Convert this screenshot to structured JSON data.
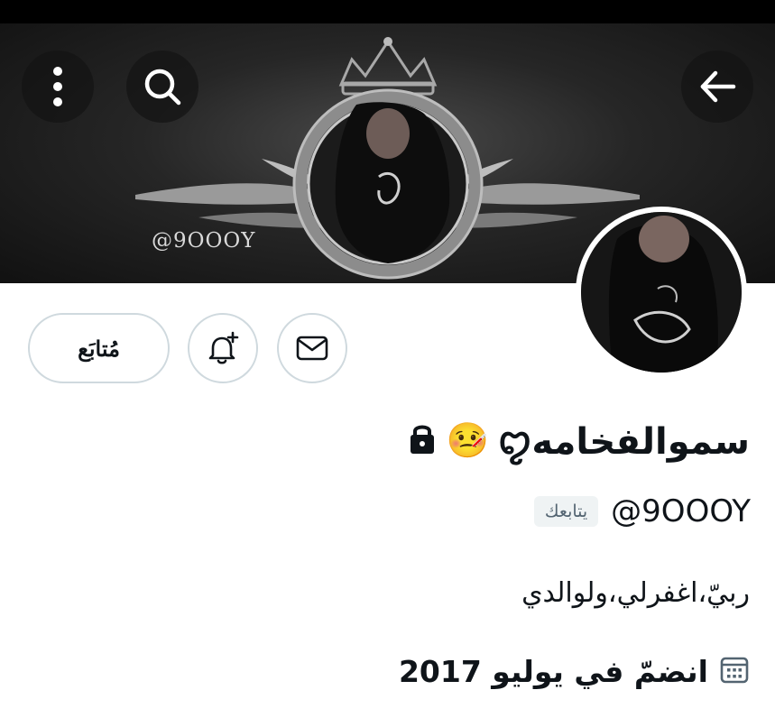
{
  "header": {
    "banner_watermark": "@9OOOY",
    "back_icon": "arrow-left-icon",
    "search_icon": "search-icon",
    "more_icon": "more-vertical-icon"
  },
  "actions": {
    "follow_label": "مُتابَع",
    "notify_icon": "bell-plus-icon",
    "message_icon": "envelope-icon"
  },
  "profile": {
    "display_name": "سموالفخامهꨄ",
    "name_emoji": "🤒",
    "protected_icon": "lock-icon",
    "handle": "@9OOOY",
    "follows_you_label": "يتابعك",
    "bio": "ربيّ،اغفرلي،ولوالدي",
    "joined": "انضمّ في يوليو 2017",
    "joined_icon": "calendar-icon"
  },
  "colors": {
    "text": "#0f1419",
    "border": "#cfd9de",
    "badge_bg": "#eff3f4",
    "badge_text": "#536471"
  }
}
